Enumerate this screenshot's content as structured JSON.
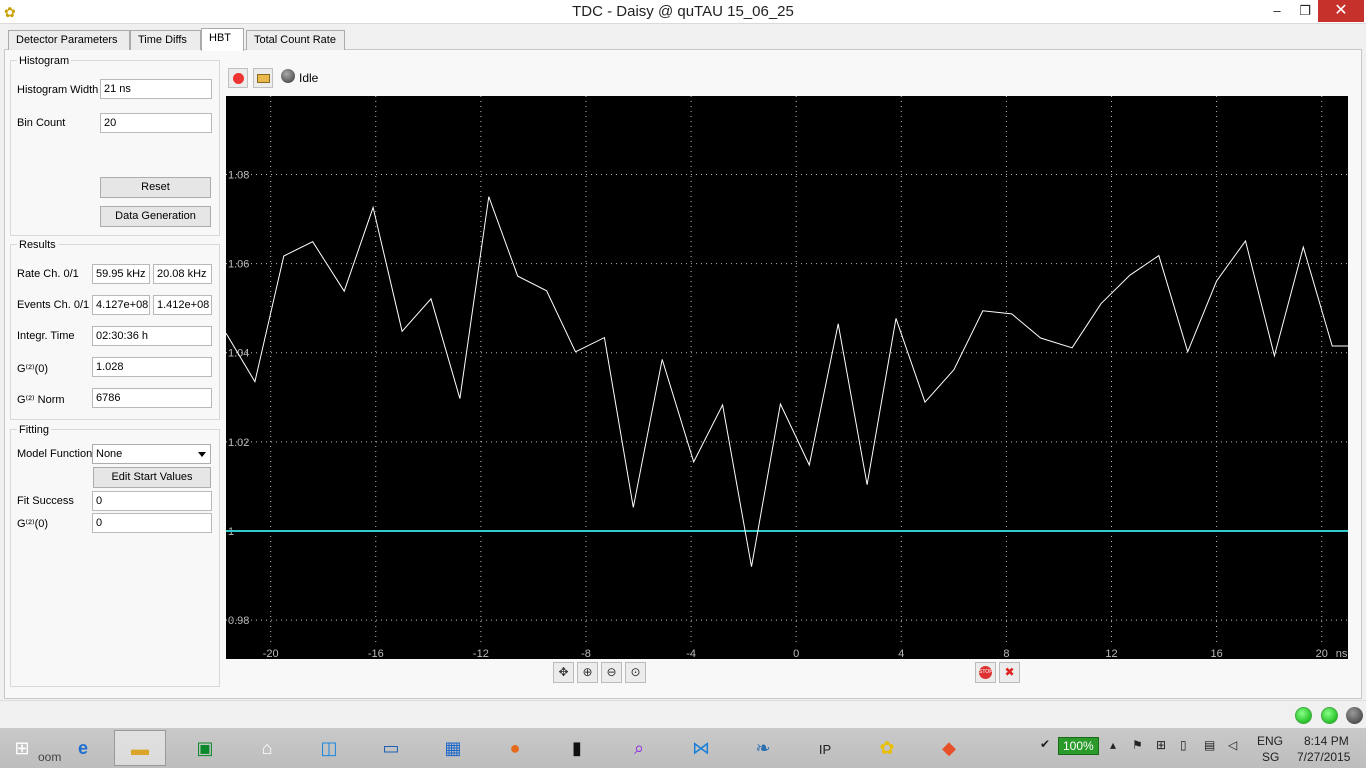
{
  "window": {
    "title": "TDC - Daisy @ quTAU 15_06_25",
    "minimize": "‒",
    "maximize": "❐",
    "close": "✕"
  },
  "tabs": [
    "Detector Parameters",
    "Time Diffs",
    "HBT",
    "Total Count Rate"
  ],
  "histogram": {
    "title": "Histogram",
    "width_label": "Histogram Width",
    "width_value": "21 ns",
    "bincount_label": "Bin Count",
    "bincount_value": "20",
    "reset_label": "Reset",
    "datagen_label": "Data Generation"
  },
  "results": {
    "title": "Results",
    "rate_label": "Rate Ch. 0/1",
    "rate_ch0": "59.95 kHz",
    "rate_ch1": "20.08 kHz",
    "events_label": "Events Ch. 0/1",
    "events_ch0": "4.127e+08",
    "events_ch1": "1.412e+08",
    "integr_label": "Integr. Time",
    "integr_value": "02:30:36 h",
    "g2_0_label": "G⁽²⁾(0)",
    "g2_0_value": "1.028",
    "g2_norm_label": "G⁽²⁾ Norm",
    "g2_norm_value": "6786"
  },
  "fitting": {
    "title": "Fitting",
    "model_label": "Model Function",
    "model_value": "None",
    "edit_label": "Edit Start Values",
    "success_label": "Fit Success",
    "success_value": "0",
    "g2_0_label": "G⁽²⁾(0)",
    "g2_0_value": "0"
  },
  "toolbar": {
    "status": "Idle"
  },
  "chart_data": {
    "type": "line",
    "x_unit": "ns",
    "xlim": [
      -21.7,
      21.0
    ],
    "ylim": [
      0.9742,
      1.0976
    ],
    "x_ticks": [
      -20,
      -16,
      -12,
      -8,
      -4,
      0,
      4,
      8,
      12,
      16,
      20
    ],
    "x_tick_labels": [
      "-20",
      "-16",
      "-12",
      "-8",
      "-4",
      "0",
      "4",
      "8",
      "12",
      "16",
      "20"
    ],
    "y_ticks": [
      0.98,
      1.0,
      1.02,
      1.04,
      1.06,
      1.08
    ],
    "y_tick_labels": [
      "0.98",
      "1",
      "1.02",
      "1.04",
      "1.06",
      "1.08"
    ],
    "grid": true,
    "colors": {
      "background": "#000000",
      "data": "#ffffff",
      "reference": "#33cccc",
      "grid": "#bbbbbb",
      "ticks": "#bbbbbb"
    },
    "series": [
      {
        "x": [
          -21.7,
          -20.6,
          -19.5,
          -18.4,
          -17.2,
          -16.1,
          -15.0,
          -13.9,
          -12.8,
          -11.7,
          -10.6,
          -9.5,
          -8.4,
          -7.3,
          -6.2,
          -5.1,
          -3.9,
          -2.8,
          -1.7,
          -0.6,
          0.5,
          1.6,
          2.7,
          3.8,
          4.9,
          6.0,
          7.1,
          8.2,
          9.3,
          10.5,
          11.6,
          12.7,
          13.8,
          14.9,
          16.0,
          17.1,
          18.2,
          19.3,
          20.4,
          21.0
        ],
        "y": [
          1.0444,
          1.0335,
          1.0617,
          1.0649,
          1.0538,
          1.0726,
          1.0448,
          1.0521,
          1.0297,
          1.075,
          1.0572,
          1.0539,
          1.0402,
          1.0434,
          1.0053,
          1.0385,
          1.0155,
          1.0283,
          0.992,
          1.0285,
          1.0148,
          1.0465,
          1.0104,
          1.0477,
          1.0289,
          1.0362,
          1.0494,
          1.0487,
          1.0433,
          1.0411,
          1.051,
          1.0574,
          1.0618,
          1.0402,
          1.0561,
          1.0651,
          1.0393,
          1.0637,
          1.0415,
          1.0415
        ]
      },
      {
        "x": [
          -21.7,
          21.0
        ],
        "y": [
          1.0,
          1.0
        ]
      }
    ]
  },
  "plot_tools": {
    "stop": "STOP",
    "clear": "✖"
  },
  "taskbar": {
    "search_partial": "oom",
    "battery": "100%",
    "language": "ENG",
    "region": "SG",
    "time": "8:14 PM",
    "date": "7/27/2015"
  }
}
